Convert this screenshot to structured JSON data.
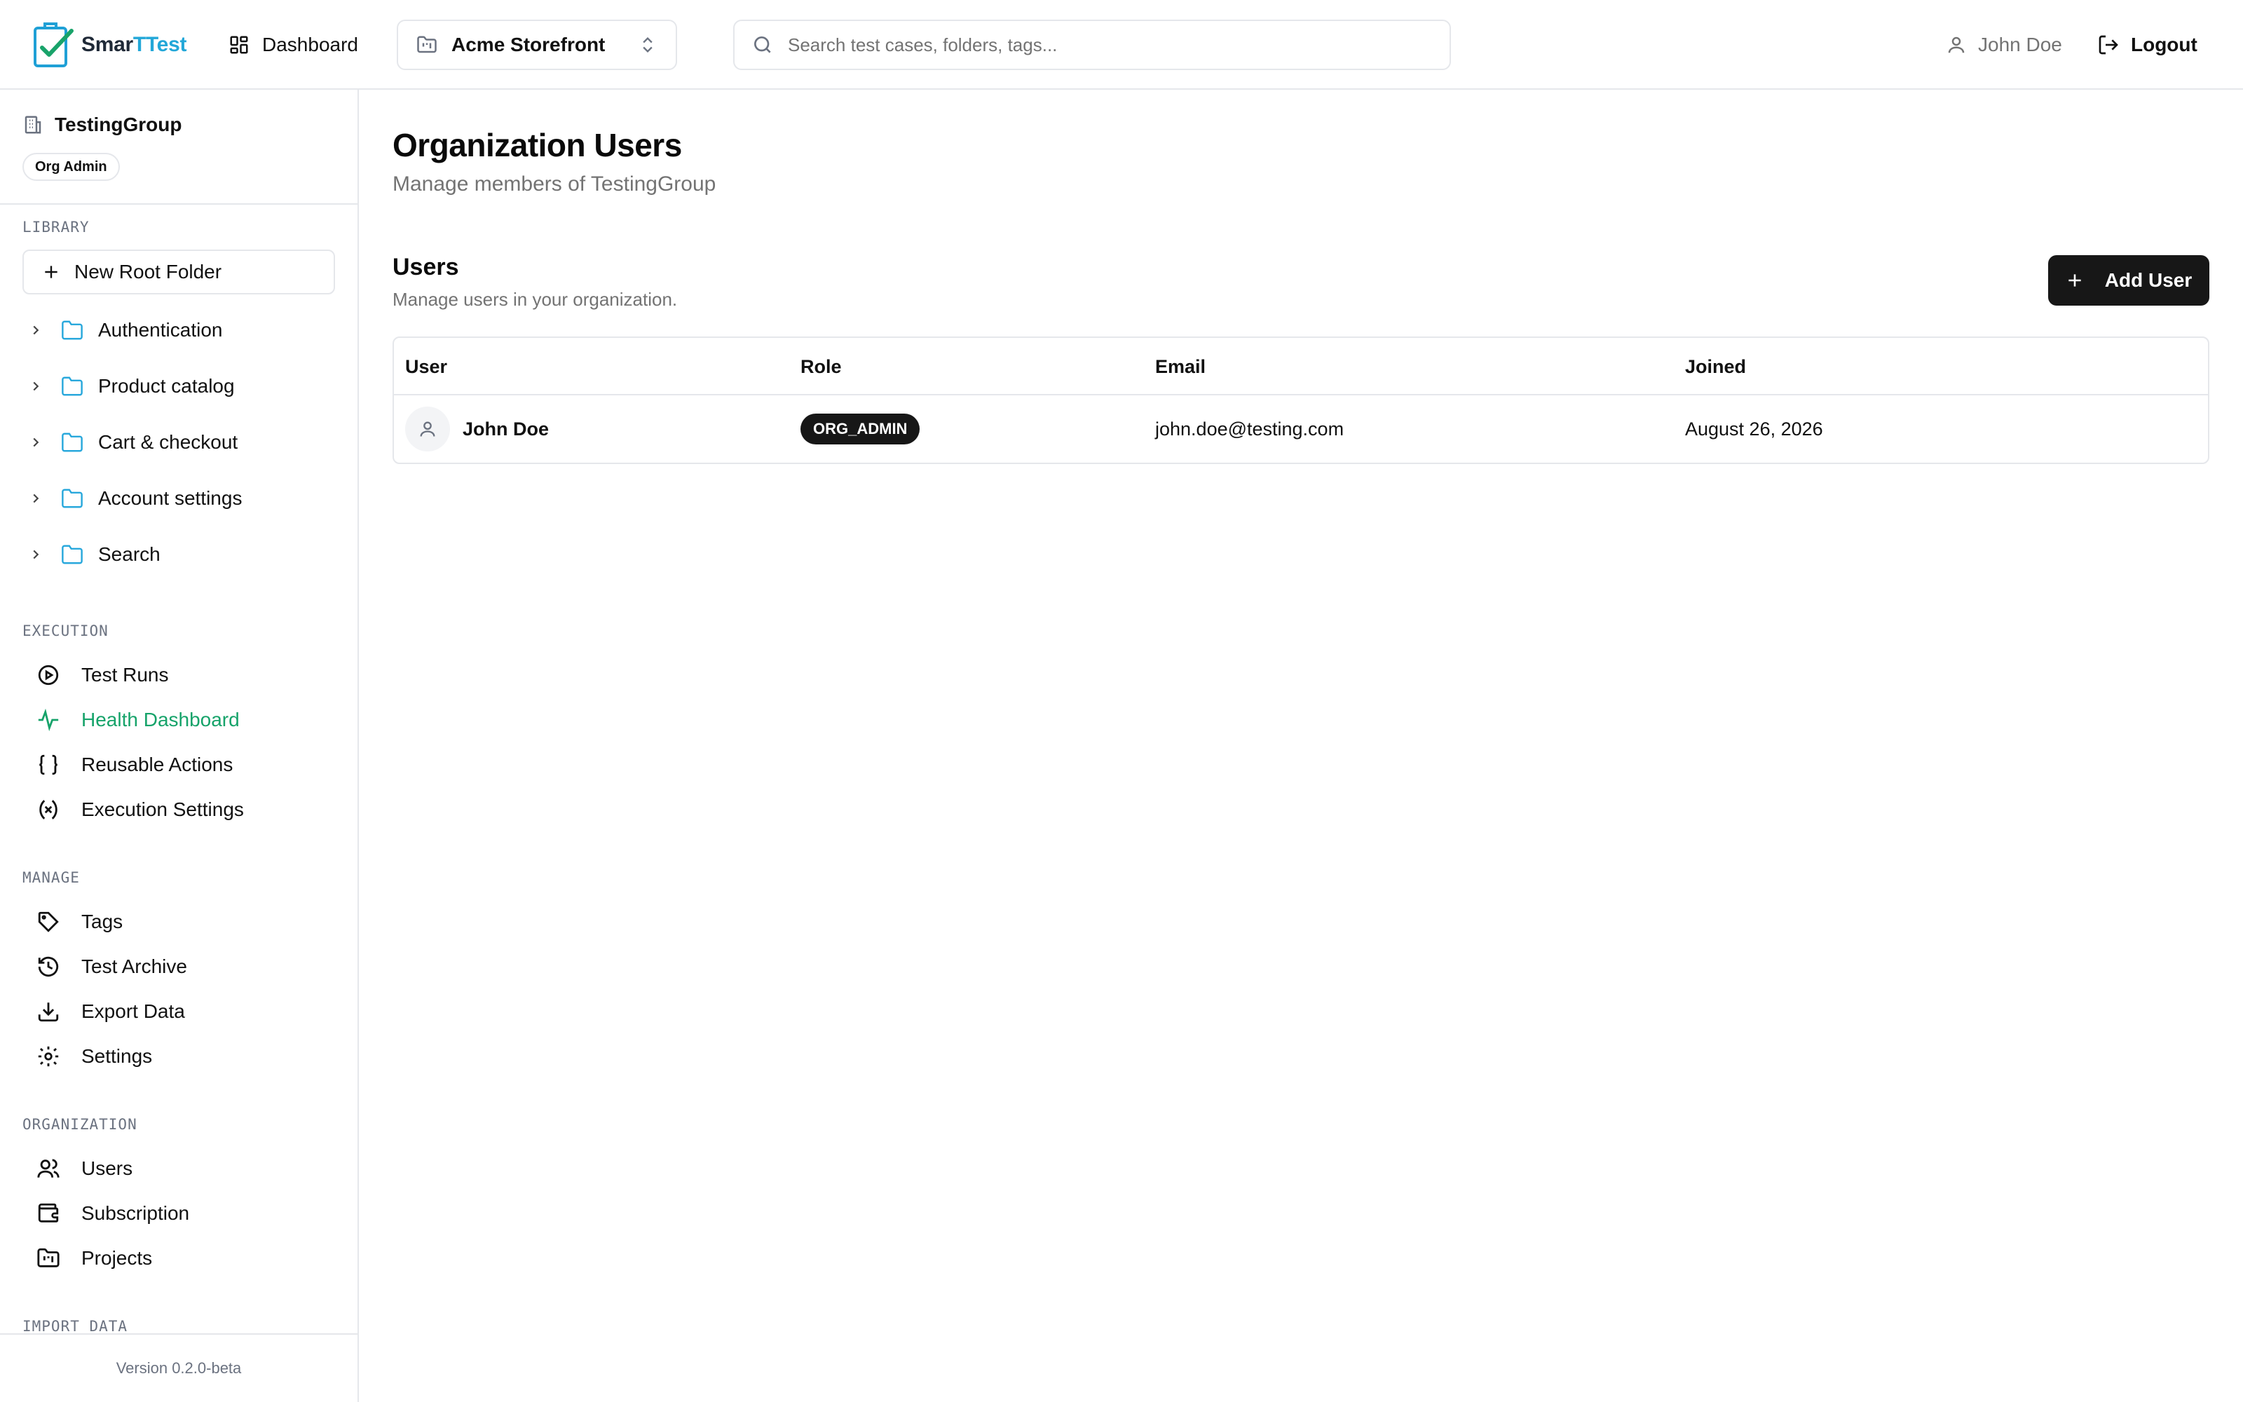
{
  "header": {
    "logo_part1": "Smar",
    "logo_part2": "TTest",
    "dashboard_label": "Dashboard",
    "project_name": "Acme Storefront",
    "search_placeholder": "Search test cases, folders, tags...",
    "user_name": "John Doe",
    "logout_label": "Logout"
  },
  "sidebar": {
    "org_name": "TestingGroup",
    "org_role": "Org Admin",
    "library_label": "LIBRARY",
    "new_root_folder": "New Root Folder",
    "folders": [
      "Authentication",
      "Product catalog",
      "Cart & checkout",
      "Account settings",
      "Search"
    ],
    "execution_label": "EXECUTION",
    "execution_items": [
      "Test Runs",
      "Health Dashboard",
      "Reusable Actions",
      "Execution Settings"
    ],
    "manage_label": "MANAGE",
    "manage_items": [
      "Tags",
      "Test Archive",
      "Export Data",
      "Settings"
    ],
    "organization_label": "ORGANIZATION",
    "organization_items": [
      "Users",
      "Subscription",
      "Projects"
    ],
    "import_label": "IMPORT DATA",
    "version": "Version 0.2.0-beta"
  },
  "main": {
    "title": "Organization Users",
    "subtitle": "Manage members of TestingGroup",
    "card_title": "Users",
    "card_subtitle": "Manage users in your organization.",
    "add_user_label": "Add User",
    "table": {
      "columns": [
        "User",
        "Role",
        "Email",
        "Joined"
      ],
      "rows": [
        {
          "name": "John Doe",
          "role": "ORG_ADMIN",
          "email": "john.doe@testing.com",
          "joined": "August 26, 2026"
        }
      ]
    }
  },
  "colors": {
    "accent_green": "#16a36a",
    "logo_blue": "#22a7d8",
    "primary_dark": "#171717"
  }
}
